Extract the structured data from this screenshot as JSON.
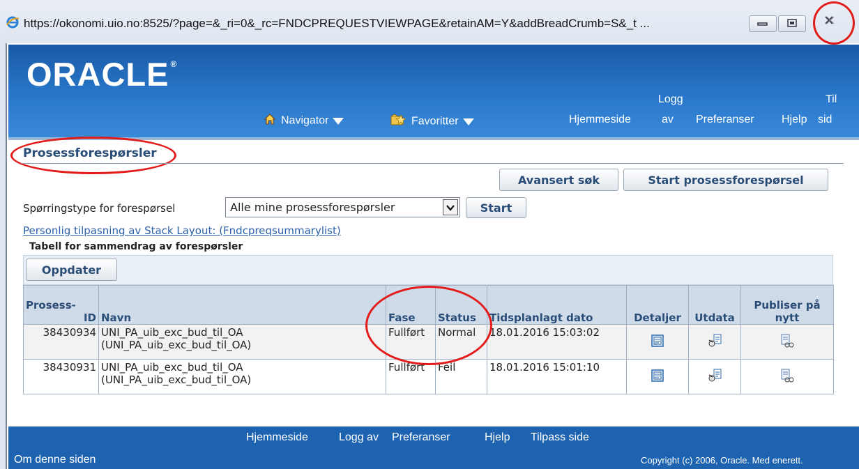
{
  "window": {
    "url": "https://okonomi.uio.no:8525/?page=&_ri=0&_rc=FNDCPREQUESTVIEWPAGE&retainAM=Y&addBreadCrumb=S&_t ..."
  },
  "header": {
    "logo": "ORACLE",
    "nav": [
      {
        "label": "Navigator"
      },
      {
        "label": "Favoritter"
      }
    ],
    "links": {
      "home": "Hjemmeside",
      "logout_line1": "Logg",
      "logout_line2": "av",
      "prefs": "Preferanser",
      "help": "Hjelp",
      "custom_line1": "Til",
      "custom_line2": "sid"
    }
  },
  "page": {
    "title": "Prosessforespørsler",
    "advanced_search": "Avansert søk",
    "start_request": "Start prosessforespørsel",
    "query_label": "Spørringstype for forespørsel",
    "query_value": "Alle mine prosessforespørsler",
    "start": "Start",
    "personalize_link": "Personlig tilpasning av Stack Layout: (Fndcpreqsummarylist)",
    "table_caption": "Tabell for sammendrag av forespørsler",
    "refresh": "Oppdater"
  },
  "table": {
    "headers": {
      "id_line1": "Prosess-",
      "id_line2": "ID",
      "name": "Navn",
      "phase": "Fase",
      "status": "Status",
      "date": "Tidsplanlagt dato",
      "details": "Detaljer",
      "output": "Utdata",
      "republish_line1": "Publiser på",
      "republish_line2": "nytt"
    },
    "rows": [
      {
        "id": "38430934",
        "name_line1": "UNI_PA_uib_exc_bud_til_OA",
        "name_line2": "(UNI_PA_uib_exc_bud_til_OA)",
        "phase": "Fullført",
        "status": "Normal",
        "date": "18.01.2016 15:03:02"
      },
      {
        "id": "38430931",
        "name_line1": "UNI_PA_uib_exc_bud_til_OA",
        "name_line2": "(UNI_PA_uib_exc_bud_til_OA)",
        "phase": "Fullført",
        "status": "Feil",
        "date": "18.01.2016 15:01:10"
      }
    ]
  },
  "footer": {
    "links": [
      "Hjemmeside",
      "Logg av",
      "Preferanser",
      "Hjelp",
      "Tilpass side"
    ],
    "about": "Om denne siden",
    "copyright": "Copyright (c) 2006, Oracle. Med enerett."
  },
  "colors": {
    "header_blue": "#2a79cc",
    "footer_blue": "#1e63b0",
    "link_blue": "#2d61a8",
    "title_blue": "#2a4d78",
    "annotation_red": "#e31b1b"
  },
  "icons": [
    "ie-icon",
    "minimize-icon",
    "restore-icon",
    "close-icon",
    "home-icon",
    "favorites-icon",
    "details-icon",
    "output-icon",
    "republish-icon"
  ]
}
